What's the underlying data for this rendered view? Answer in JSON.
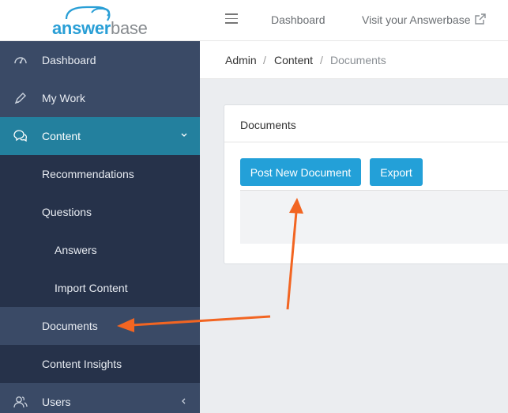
{
  "brand": {
    "logo_part1": "answ",
    "logo_part2": "er",
    "logo_part3": "base"
  },
  "header": {
    "dashboard_link": "Dashboard",
    "visit_link": "Visit your Answerbase"
  },
  "sidebar": {
    "items": [
      {
        "label": "Dashboard",
        "icon": "speedometer-icon"
      },
      {
        "label": "My Work",
        "icon": "pen-icon"
      },
      {
        "label": "Content",
        "icon": "chat-bubbles-icon"
      },
      {
        "label": "Recommendations"
      },
      {
        "label": "Questions"
      },
      {
        "label": "Answers"
      },
      {
        "label": "Import Content"
      },
      {
        "label": "Documents"
      },
      {
        "label": "Content Insights"
      },
      {
        "label": "Users",
        "icon": "users-icon"
      }
    ]
  },
  "breadcrumb": {
    "items": [
      "Admin",
      "Content",
      "Documents"
    ],
    "separator": "/"
  },
  "card": {
    "title": "Documents",
    "post_button": "Post New Document",
    "export_button": "Export"
  },
  "colors": {
    "sidebar_bg": "#2f3d55",
    "active_bg": "#23809e",
    "button_bg": "#23a0d8",
    "arrow": "#f26522"
  }
}
